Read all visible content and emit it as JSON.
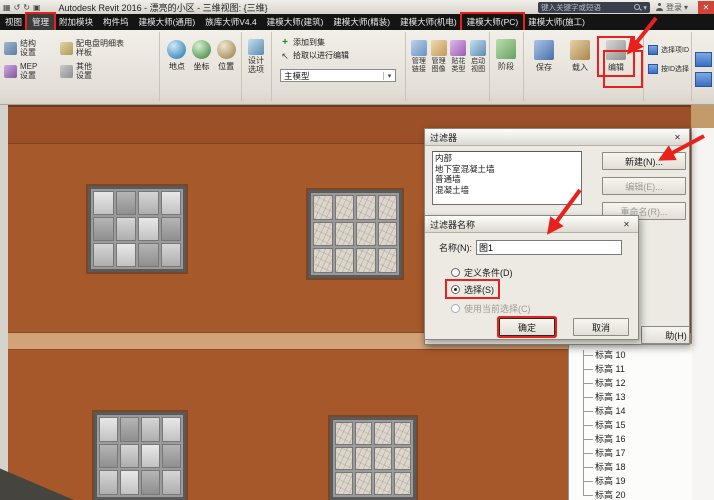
{
  "titlebar": {
    "title": "Autodesk Revit 2016 - 漂亮的小区 - 三维视图: {三维}",
    "search_placeholder": "键入关键字或短语",
    "login": "登录"
  },
  "icons": {
    "qat": [
      "▦",
      "↺",
      "↻",
      "▣"
    ],
    "caret": "▾",
    "close": "✕"
  },
  "tabs": [
    "视图",
    "管理",
    "附加模块",
    "构件坞",
    "建模大师(通用)",
    "族库大师V4.4",
    "建模大师(建筑)",
    "建模大师(精装)",
    "建模大师(机电)",
    "建模大师(PC)",
    "建模大师(施工)"
  ],
  "ribbon": {
    "settings": {
      "structure": "结构\n设置",
      "mep": "MEP\n设置",
      "panel_schedule": "配电盘明细表\n样板",
      "other": "其他\n设置"
    },
    "project_location": {
      "place": "地点",
      "coords": "坐标",
      "position": "位置"
    },
    "design_options": "设计\n选项",
    "selection_set": {
      "add": "添加到集",
      "pick": "拾取以进行编辑",
      "combo": "主模型"
    },
    "manage_project": {
      "links": "管理\n链接",
      "images": "管理\n图像",
      "decal": "贴花\n类型",
      "starting_view": "启动\n视图"
    },
    "phasing": "阶段",
    "selection": {
      "save": "保存",
      "load": "载入",
      "edit": "编辑"
    },
    "inquiry": {
      "ids": "选择项ID",
      "by_id": "按ID选择"
    }
  },
  "dialog_filters": {
    "title": "过滤器",
    "list": [
      "内部",
      "地下室混凝土墙",
      "普通墙",
      "混凝土墙"
    ],
    "new_btn": "新建(N)...",
    "edit_btn": "编辑(E)...",
    "rename_btn": "重命名(R)...",
    "help_partial": "助(H)"
  },
  "dialog_filter_name": {
    "title": "过滤器名称",
    "name_label": "名称(N):",
    "name_value": "图1",
    "radio_define": "定义条件(D)",
    "radio_select": "选择(S)",
    "radio_use_current": "使用当前选择(C)",
    "ok": "确定",
    "cancel": "取消"
  },
  "levels": [
    "标高 10",
    "标高 11",
    "标高 12",
    "标高 13",
    "标高 14",
    "标高 15",
    "标高 16",
    "标高 17",
    "标高 18",
    "标高 19",
    "标高 20"
  ],
  "colors": {
    "wall": "#a65a2c",
    "wall_dark": "#9b5027",
    "wall_stripe": "#d2a377",
    "annotation": "#e8211c"
  }
}
